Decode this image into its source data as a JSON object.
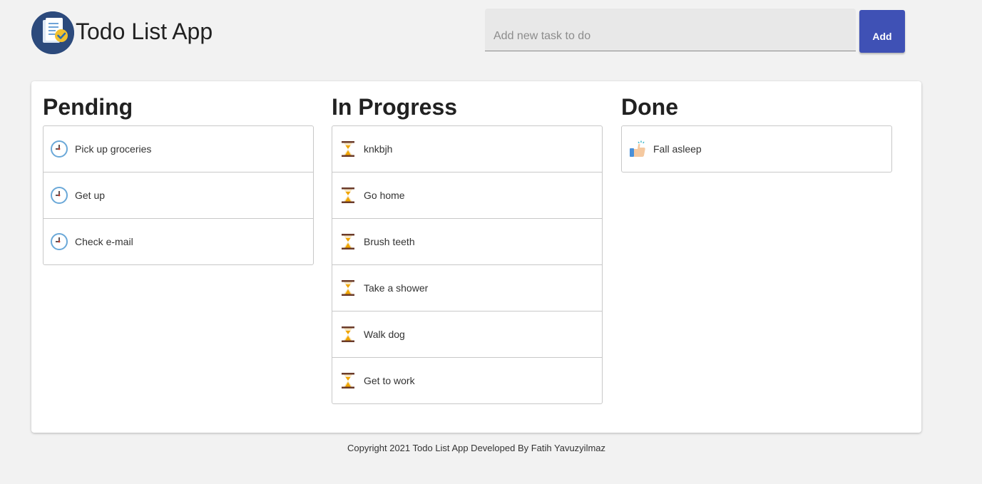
{
  "header": {
    "app_title": "Todo List App",
    "logo_icon": "todo-document-check-icon",
    "input_placeholder": "Add new task to do",
    "input_value": "",
    "add_button_label": "Add",
    "accent_color": "#3f51b5"
  },
  "columns": [
    {
      "title": "Pending",
      "icon": "clock-icon",
      "tasks": [
        "Pick up groceries",
        "Get up",
        "Check e-mail"
      ]
    },
    {
      "title": "In Progress",
      "icon": "hourglass-icon",
      "tasks": [
        "knkbjh",
        "Go home",
        "Brush teeth",
        "Take a shower",
        "Walk dog",
        "Get to work"
      ]
    },
    {
      "title": "Done",
      "icon": "thumbs-up-icon",
      "tasks": [
        "Fall asleep"
      ]
    }
  ],
  "footer": {
    "text": "Copyright 2021 Todo List App Developed By Fatih Yavuzyilmaz"
  }
}
